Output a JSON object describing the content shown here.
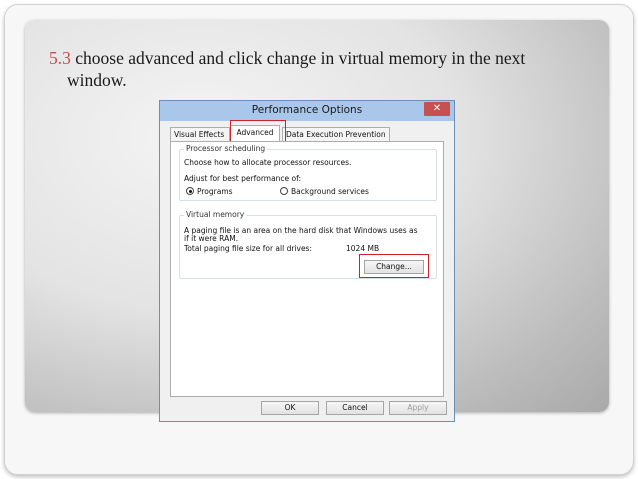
{
  "slide": {
    "step_number": "5.3",
    "text_line1": "choose advanced and click change in virtual memory in the next",
    "text_line2": "window."
  },
  "dialog": {
    "title": "Performance Options",
    "close_glyph": "✕",
    "tabs": [
      "Visual Effects",
      "Advanced",
      "Data Execution Prevention"
    ],
    "active_tab": "Advanced",
    "processor": {
      "group_title": "Processor scheduling",
      "description": "Choose how to allocate processor resources.",
      "adjust_label": "Adjust for best performance of:",
      "option_programs": "Programs",
      "option_background": "Background services",
      "selected": "Programs"
    },
    "virtual_memory": {
      "group_title": "Virtual memory",
      "description_line1": "A paging file is an area on the hard disk that Windows uses as",
      "description_line2": "if it were RAM.",
      "total_label": "Total paging file size for all drives:",
      "total_value": "1024 MB",
      "change_button": "Change..."
    },
    "buttons": {
      "ok": "OK",
      "cancel": "Cancel",
      "apply": "Apply"
    },
    "colors": {
      "titlebar": "#a9c7ea",
      "close": "#c75050",
      "highlight": "#d0202a"
    }
  }
}
